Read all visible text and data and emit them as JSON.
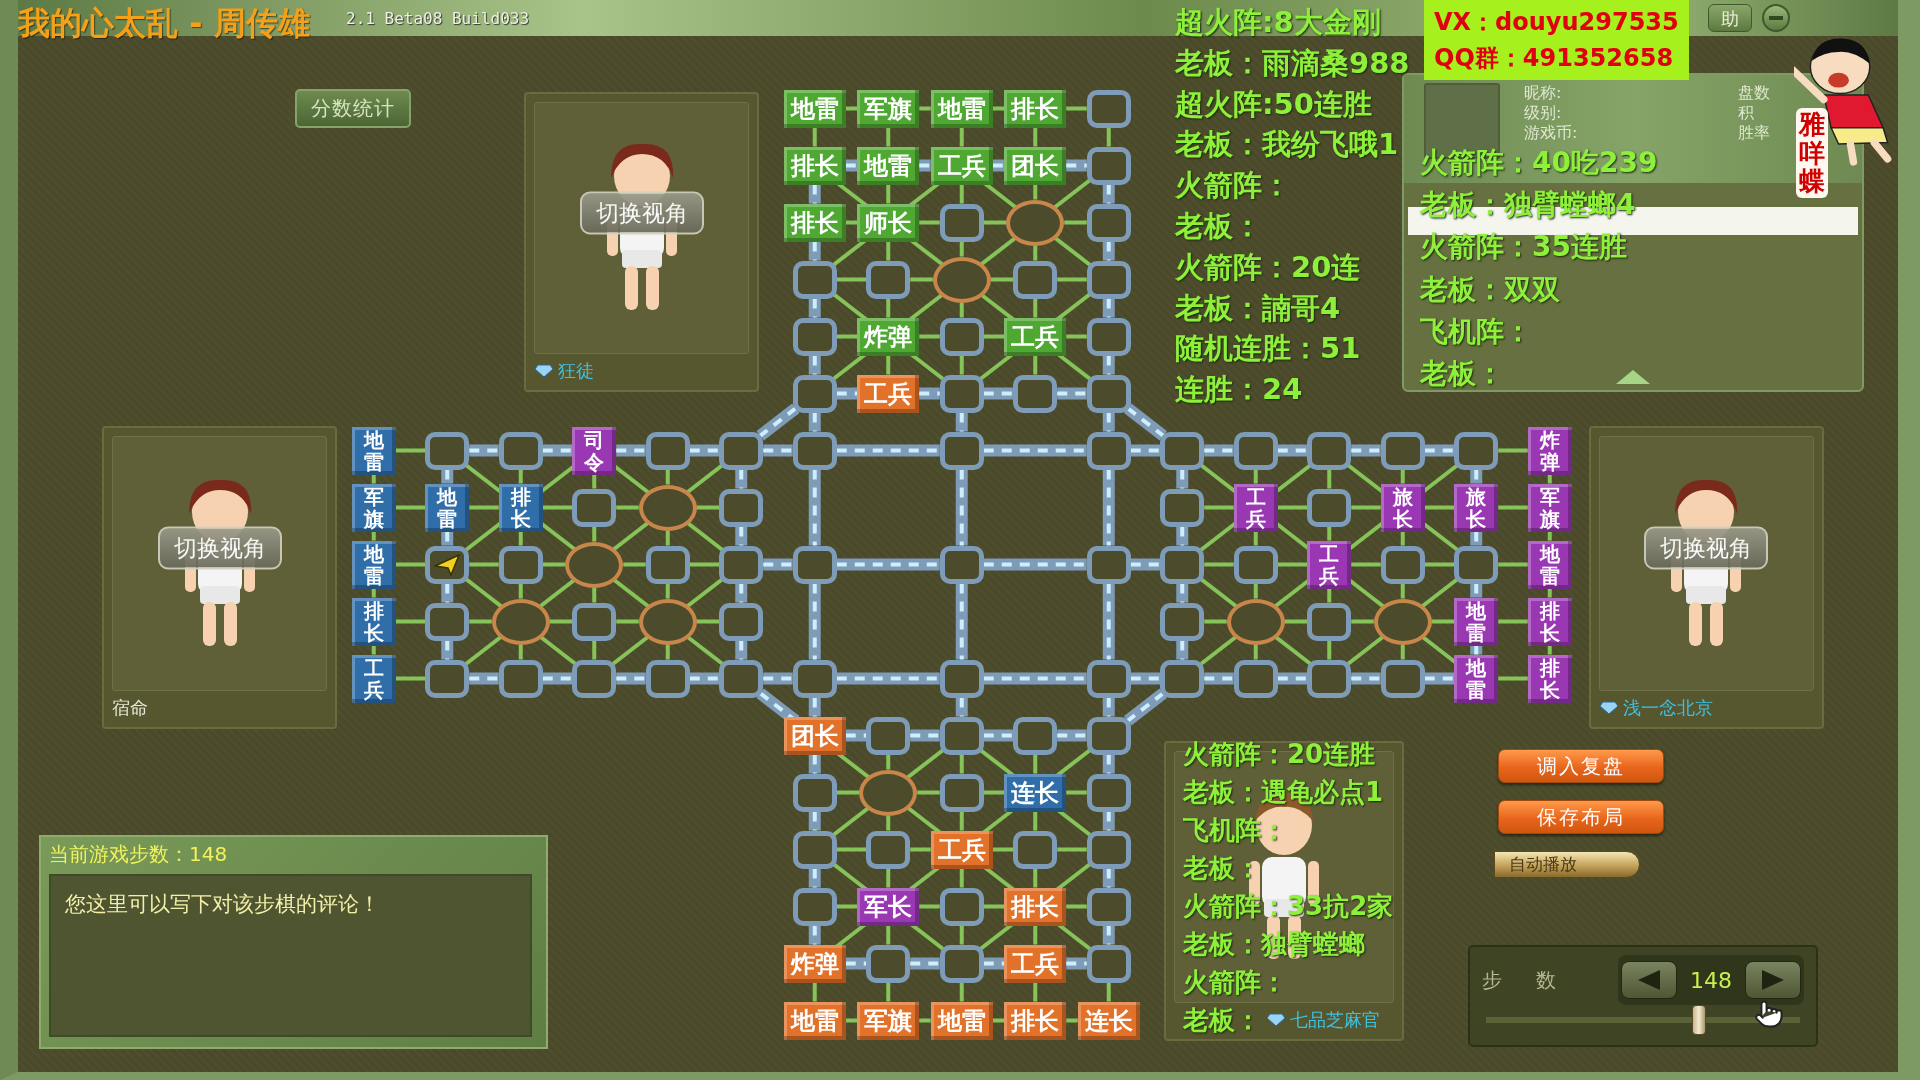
{
  "window": {
    "title": "2.1 Beta08 Build033",
    "help_button": "助"
  },
  "score_button": "分数统计",
  "players": [
    {
      "name": "狂徒",
      "vip": true,
      "switch_view": "切换视角"
    },
    {
      "name": "宿命",
      "vip": false,
      "switch_view": "切换视角"
    },
    {
      "name": "浅一念北京",
      "vip": true,
      "switch_view": "切换视角"
    },
    {
      "name": "七品芝麻官",
      "vip": true
    }
  ],
  "board": {
    "top": {
      "rows": [
        [
          {
            "piece": "地雷",
            "color": "#4fa832"
          },
          {
            "piece": "军旗",
            "color": "#4fa832"
          },
          {
            "piece": "地雷",
            "color": "#4fa832"
          },
          {
            "piece": "排长",
            "color": "#4fa832"
          },
          null
        ],
        [
          {
            "piece": "排长",
            "color": "#4fa832"
          },
          {
            "piece": "地雷",
            "color": "#4fa832"
          },
          {
            "piece": "工兵",
            "color": "#4fa832"
          },
          {
            "piece": "团长",
            "color": "#4fa832"
          },
          null
        ],
        [
          {
            "piece": "排长",
            "color": "#4fa832"
          },
          {
            "piece": "师长",
            "color": "#4fa832"
          },
          null,
          null,
          null
        ],
        [
          null,
          null,
          null,
          null,
          null
        ],
        [
          null,
          {
            "piece": "炸弹",
            "color": "#4fa832"
          },
          null,
          {
            "piece": "工兵",
            "color": "#4fa832"
          },
          null
        ],
        [
          null,
          {
            "piece": "工兵",
            "color": "#e2712a"
          },
          null,
          null,
          null
        ]
      ]
    },
    "left": {
      "rows": [
        [
          {
            "piece": "地雷",
            "color": "#2f6ea8"
          },
          null,
          null,
          {
            "piece": "司令",
            "color": "#9a38b4"
          },
          null,
          null
        ],
        [
          {
            "piece": "军旗",
            "color": "#2f6ea8"
          },
          {
            "piece": "地雷",
            "color": "#2f6ea8"
          },
          {
            "piece": "排长",
            "color": "#2f6ea8"
          },
          null,
          null,
          null
        ],
        [
          {
            "piece": "地雷",
            "color": "#2f6ea8"
          },
          {
            "last_move": true
          },
          null,
          null,
          null,
          null
        ],
        [
          {
            "piece": "排长",
            "color": "#2f6ea8"
          },
          null,
          null,
          null,
          null,
          null
        ],
        [
          {
            "piece": "工兵",
            "color": "#2f6ea8"
          },
          null,
          null,
          null,
          null,
          null
        ]
      ]
    },
    "right": {
      "rows": [
        [
          null,
          null,
          null,
          null,
          null,
          {
            "piece": "炸弹",
            "color": "#9a38b4"
          }
        ],
        [
          null,
          {
            "piece": "工兵",
            "color": "#9a38b4"
          },
          null,
          {
            "piece": "旅长",
            "color": "#9a38b4"
          },
          {
            "piece": "旅长",
            "color": "#9a38b4"
          },
          {
            "piece": "军旗",
            "color": "#9a38b4"
          }
        ],
        [
          null,
          null,
          {
            "piece": "工兵",
            "color": "#9a38b4"
          },
          null,
          null,
          {
            "piece": "地雷",
            "color": "#9a38b4"
          }
        ],
        [
          null,
          null,
          null,
          null,
          {
            "piece": "地雷",
            "color": "#9a38b4"
          },
          {
            "piece": "排长",
            "color": "#9a38b4"
          }
        ],
        [
          null,
          null,
          null,
          null,
          {
            "piece": "地雷",
            "color": "#9a38b4"
          },
          {
            "piece": "排长",
            "color": "#9a38b4"
          }
        ]
      ]
    },
    "bottom": {
      "rows": [
        [
          {
            "piece": "团长",
            "color": "#e2712a"
          },
          null,
          null,
          null,
          null
        ],
        [
          null,
          null,
          null,
          {
            "piece": "连长",
            "color": "#2f6ea8"
          },
          null
        ],
        [
          null,
          null,
          {
            "piece": "工兵",
            "color": "#e2712a"
          },
          null,
          null
        ],
        [
          null,
          {
            "piece": "军长",
            "color": "#9a38b4"
          },
          null,
          {
            "piece": "排长",
            "color": "#e2712a"
          },
          null
        ],
        [
          {
            "piece": "炸弹",
            "color": "#e2712a"
          },
          null,
          null,
          {
            "piece": "工兵",
            "color": "#e2712a"
          },
          null
        ],
        [
          {
            "piece": "地雷",
            "color": "#e2712a"
          },
          {
            "piece": "军旗",
            "color": "#e2712a"
          },
          {
            "piece": "地雷",
            "color": "#e2712a"
          },
          {
            "piece": "排长",
            "color": "#e2712a"
          },
          {
            "piece": "连长",
            "color": "#e2712a"
          }
        ]
      ]
    }
  },
  "comment": {
    "title": "当前游戏步数：148",
    "text": "您这里可以写下对该步棋的评论！"
  },
  "info_panel": {
    "labels_left": [
      "昵称:",
      "级别:",
      "游戏币:"
    ],
    "labels_right": [
      "盘数",
      "积",
      "胜率"
    ]
  },
  "actions": [
    {
      "label": "调入复盘",
      "kind": "orange"
    },
    {
      "label": "保存布局",
      "kind": "orange"
    },
    {
      "label": "自动播放",
      "kind": "bullet"
    }
  ],
  "step_control": {
    "label": "步 数",
    "value": "148",
    "level": 0.68
  },
  "overlays": {
    "song": "我的心太乱 - 周传雄",
    "contact": [
      "VX：douyu297535",
      "QQ群：491352658"
    ],
    "left_notes": [
      "超火阵:8大金刚",
      "老板：雨滴桑988",
      "超火阵:50连胜",
      "老板：我纷飞哦1",
      "火箭阵：",
      "老板：",
      "火箭阵：20连",
      "老板：諵哥4",
      "随机连胜：51",
      "连胜：24"
    ],
    "right_notes": [
      "火箭阵：40吃239",
      "老板：独臂螳螂4",
      "火箭阵：35连胜",
      "老板：双双",
      "飞机阵：",
      "老板："
    ],
    "bottom_notes": [
      "火箭阵：20连胜",
      "老板：遇龟必点1",
      "飞机阵：",
      "老板：",
      "火箭阵：33抗2家",
      "老板：独臂螳螂",
      "火箭阵：",
      "老板："
    ],
    "sticker_text": "雅咩蝶"
  }
}
